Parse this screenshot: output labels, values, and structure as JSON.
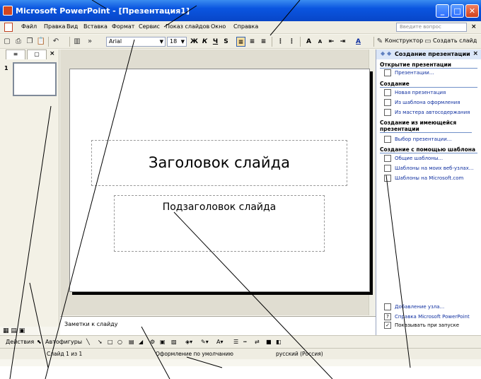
{
  "window": {
    "title": "Microsoft PowerPoint - [Презентация1]",
    "controls": {
      "minimize": "_",
      "maximize": "□",
      "close": "✕"
    }
  },
  "menubar": {
    "items": [
      "Файл",
      "Правка",
      "Вид",
      "Вставка",
      "Формат",
      "Сервис",
      "Показ слайдов",
      "Окно",
      "Справка"
    ],
    "help_placeholder": "Введите вопрос",
    "close": "×"
  },
  "toolbar": {
    "font": "Arial",
    "size": "18",
    "format_buttons": [
      "Ж",
      "К",
      "Ч",
      "S"
    ],
    "designer_label": "Конструктор",
    "new_slide_label": "Создать слайд"
  },
  "left_panel": {
    "close": "×",
    "slide_number": "1"
  },
  "slide": {
    "title": "Заголовок слайда",
    "subtitle": "Подзаголовок слайда"
  },
  "notes": {
    "placeholder": "Заметки к слайду"
  },
  "taskpane": {
    "title": "Создание презентации",
    "close": "×",
    "sections": [
      {
        "heading": "Открытие презентации",
        "links": [
          "Презентации..."
        ]
      },
      {
        "heading": "Создание",
        "links": [
          "Новая презентация",
          "Из шаблона оформления",
          "Из мастера автосодержания"
        ]
      },
      {
        "heading": "Создание из имеющейся презентации",
        "links": [
          "Выбор презентации..."
        ]
      },
      {
        "heading": "Создание с помощью шаблона",
        "links": [
          "Общие шаблоны...",
          "Шаблоны на моих веб-узлах...",
          "Шаблоны на Microsoft.com"
        ]
      }
    ],
    "footer_links": [
      "Добавление узла...",
      "Справка Microsoft PowerPoint",
      "Показывать при запуске"
    ]
  },
  "drawbar": {
    "actions": "Действия",
    "autoshapes": "Автофигуры"
  },
  "status": {
    "slide": "Слайд 1 из 1",
    "design": "Оформление по умолчанию",
    "language": "русский (Россия)"
  },
  "colors": {
    "titlebar": "#0a55e0",
    "chrome": "#efede2",
    "link": "#1030a0"
  }
}
